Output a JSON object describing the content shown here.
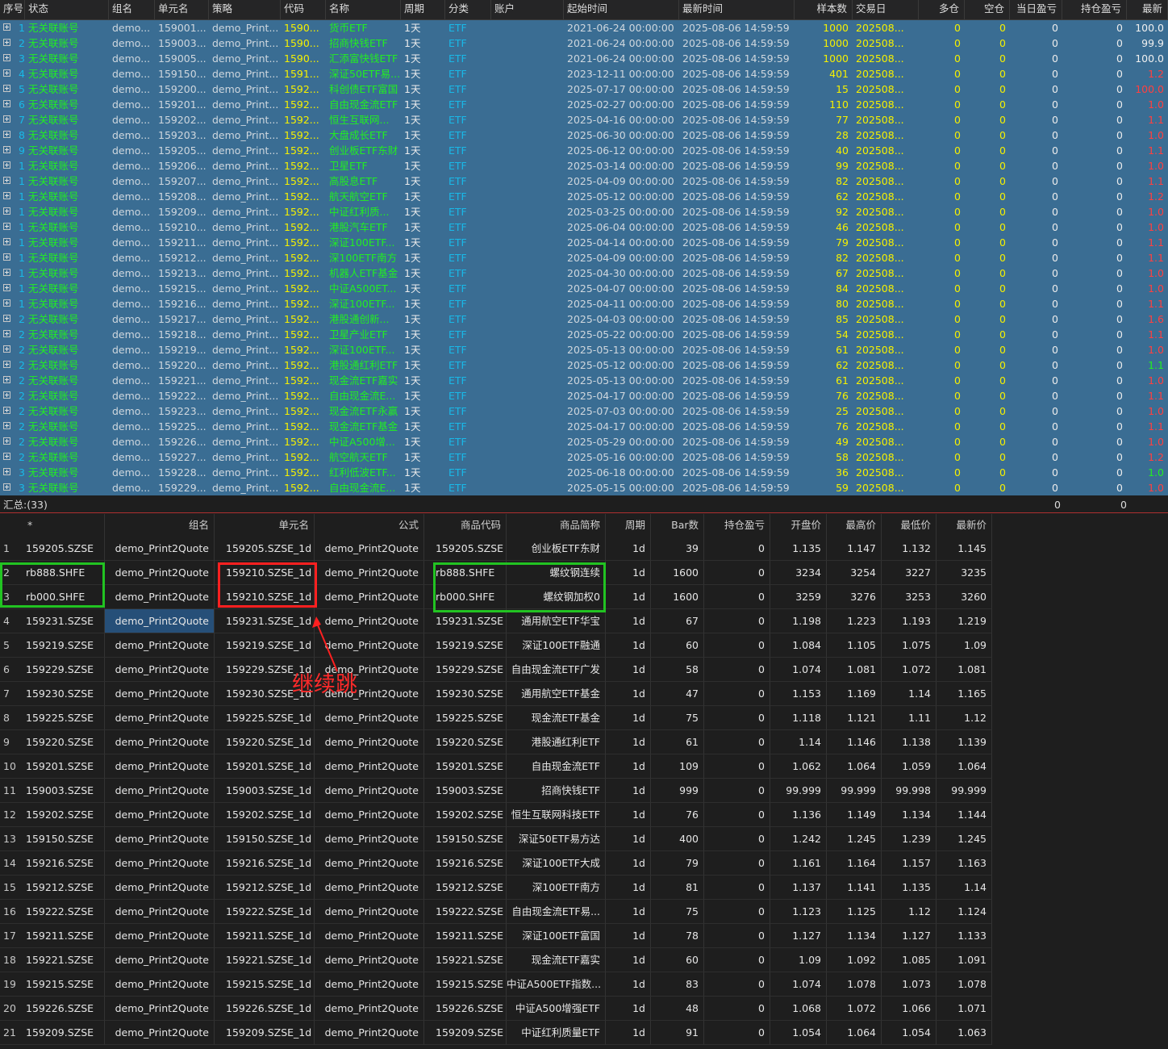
{
  "top": {
    "headers": [
      "序号",
      "状态",
      "组名",
      "单元名",
      "策略",
      "代码",
      "名称",
      "周期",
      "分类",
      "账户",
      "起始时间",
      "最新时间",
      "样本数",
      "交易日",
      "多仓",
      "空仓",
      "当日盈亏",
      "持仓盈亏",
      "最新"
    ],
    "rows": [
      [
        "1",
        "无关联账号",
        "demo...",
        "159001...",
        "demo_Print...",
        "1590...",
        "货币ETF",
        "1天",
        "ETF",
        "",
        "2021-06-24 00:00:00",
        "2025-08-06 14:59:59",
        "1000",
        "202508...",
        "0",
        "0",
        "0",
        "0",
        "100.0"
      ],
      [
        "2",
        "无关联账号",
        "demo...",
        "159003...",
        "demo_Print...",
        "1590...",
        "招商快钱ETF",
        "1天",
        "ETF",
        "",
        "2021-06-24 00:00:00",
        "2025-08-06 14:59:59",
        "1000",
        "202508...",
        "0",
        "0",
        "0",
        "0",
        "99.9"
      ],
      [
        "3",
        "无关联账号",
        "demo...",
        "159005...",
        "demo_Print...",
        "1590...",
        "汇添富快钱ETF",
        "1天",
        "ETF",
        "",
        "2021-06-24 00:00:00",
        "2025-08-06 14:59:59",
        "1000",
        "202508...",
        "0",
        "0",
        "0",
        "0",
        "100.0"
      ],
      [
        "4",
        "无关联账号",
        "demo...",
        "159150...",
        "demo_Print...",
        "1591...",
        "深证50ETF易...",
        "1天",
        "ETF",
        "",
        "2023-12-11 00:00:00",
        "2025-08-06 14:59:59",
        "401",
        "202508...",
        "0",
        "0",
        "0",
        "0",
        "1.2"
      ],
      [
        "5",
        "无关联账号",
        "demo...",
        "159200...",
        "demo_Print...",
        "1592...",
        "科创债ETF富国",
        "1天",
        "ETF",
        "",
        "2025-07-17 00:00:00",
        "2025-08-06 14:59:59",
        "15",
        "202508...",
        "0",
        "0",
        "0",
        "0",
        "100.0"
      ],
      [
        "6",
        "无关联账号",
        "demo...",
        "159201...",
        "demo_Print...",
        "1592...",
        "自由现金流ETF",
        "1天",
        "ETF",
        "",
        "2025-02-27 00:00:00",
        "2025-08-06 14:59:59",
        "110",
        "202508...",
        "0",
        "0",
        "0",
        "0",
        "1.0"
      ],
      [
        "7",
        "无关联账号",
        "demo...",
        "159202...",
        "demo_Print...",
        "1592...",
        "恒生互联网...",
        "1天",
        "ETF",
        "",
        "2025-04-16 00:00:00",
        "2025-08-06 14:59:59",
        "77",
        "202508...",
        "0",
        "0",
        "0",
        "0",
        "1.1"
      ],
      [
        "8",
        "无关联账号",
        "demo...",
        "159203...",
        "demo_Print...",
        "1592...",
        "大盘成长ETF",
        "1天",
        "ETF",
        "",
        "2025-06-30 00:00:00",
        "2025-08-06 14:59:59",
        "28",
        "202508...",
        "0",
        "0",
        "0",
        "0",
        "1.0"
      ],
      [
        "9",
        "无关联账号",
        "demo...",
        "159205...",
        "demo_Print...",
        "1592...",
        "创业板ETF东财",
        "1天",
        "ETF",
        "",
        "2025-06-12 00:00:00",
        "2025-08-06 14:59:59",
        "40",
        "202508...",
        "0",
        "0",
        "0",
        "0",
        "1.1"
      ],
      [
        "10",
        "无关联账号",
        "demo...",
        "159206...",
        "demo_Print...",
        "1592...",
        "卫星ETF",
        "1天",
        "ETF",
        "",
        "2025-03-14 00:00:00",
        "2025-08-06 14:59:59",
        "99",
        "202508...",
        "0",
        "0",
        "0",
        "0",
        "1.0"
      ],
      [
        "11",
        "无关联账号",
        "demo...",
        "159207...",
        "demo_Print...",
        "1592...",
        "高股息ETF",
        "1天",
        "ETF",
        "",
        "2025-04-09 00:00:00",
        "2025-08-06 14:59:59",
        "82",
        "202508...",
        "0",
        "0",
        "0",
        "0",
        "1.1"
      ],
      [
        "12",
        "无关联账号",
        "demo...",
        "159208...",
        "demo_Print...",
        "1592...",
        "航天航空ETF",
        "1天",
        "ETF",
        "",
        "2025-05-12 00:00:00",
        "2025-08-06 14:59:59",
        "62",
        "202508...",
        "0",
        "0",
        "0",
        "0",
        "1.2"
      ],
      [
        "13",
        "无关联账号",
        "demo...",
        "159209...",
        "demo_Print...",
        "1592...",
        "中证红利质...",
        "1天",
        "ETF",
        "",
        "2025-03-25 00:00:00",
        "2025-08-06 14:59:59",
        "92",
        "202508...",
        "0",
        "0",
        "0",
        "0",
        "1.0"
      ],
      [
        "14",
        "无关联账号",
        "demo...",
        "159210...",
        "demo_Print...",
        "1592...",
        "港股汽车ETF",
        "1天",
        "ETF",
        "",
        "2025-06-04 00:00:00",
        "2025-08-06 14:59:59",
        "46",
        "202508...",
        "0",
        "0",
        "0",
        "0",
        "1.0"
      ],
      [
        "15",
        "无关联账号",
        "demo...",
        "159211...",
        "demo_Print...",
        "1592...",
        "深证100ETF...",
        "1天",
        "ETF",
        "",
        "2025-04-14 00:00:00",
        "2025-08-06 14:59:59",
        "79",
        "202508...",
        "0",
        "0",
        "0",
        "0",
        "1.1"
      ],
      [
        "16",
        "无关联账号",
        "demo...",
        "159212...",
        "demo_Print...",
        "1592...",
        "深100ETF南方",
        "1天",
        "ETF",
        "",
        "2025-04-09 00:00:00",
        "2025-08-06 14:59:59",
        "82",
        "202508...",
        "0",
        "0",
        "0",
        "0",
        "1.1"
      ],
      [
        "17",
        "无关联账号",
        "demo...",
        "159213...",
        "demo_Print...",
        "1592...",
        "机器人ETF基金",
        "1天",
        "ETF",
        "",
        "2025-04-30 00:00:00",
        "2025-08-06 14:59:59",
        "67",
        "202508...",
        "0",
        "0",
        "0",
        "0",
        "1.0"
      ],
      [
        "18",
        "无关联账号",
        "demo...",
        "159215...",
        "demo_Print...",
        "1592...",
        "中证A500ET...",
        "1天",
        "ETF",
        "",
        "2025-04-07 00:00:00",
        "2025-08-06 14:59:59",
        "84",
        "202508...",
        "0",
        "0",
        "0",
        "0",
        "1.0"
      ],
      [
        "19",
        "无关联账号",
        "demo...",
        "159216...",
        "demo_Print...",
        "1592...",
        "深证100ETF...",
        "1天",
        "ETF",
        "",
        "2025-04-11 00:00:00",
        "2025-08-06 14:59:59",
        "80",
        "202508...",
        "0",
        "0",
        "0",
        "0",
        "1.1"
      ],
      [
        "20",
        "无关联账号",
        "demo...",
        "159217...",
        "demo_Print...",
        "1592...",
        "港股通创新...",
        "1天",
        "ETF",
        "",
        "2025-04-03 00:00:00",
        "2025-08-06 14:59:59",
        "85",
        "202508...",
        "0",
        "0",
        "0",
        "0",
        "1.6"
      ],
      [
        "21",
        "无关联账号",
        "demo...",
        "159218...",
        "demo_Print...",
        "1592...",
        "卫星产业ETF",
        "1天",
        "ETF",
        "",
        "2025-05-22 00:00:00",
        "2025-08-06 14:59:59",
        "54",
        "202508...",
        "0",
        "0",
        "0",
        "0",
        "1.1"
      ],
      [
        "22",
        "无关联账号",
        "demo...",
        "159219...",
        "demo_Print...",
        "1592...",
        "深证100ETF...",
        "1天",
        "ETF",
        "",
        "2025-05-13 00:00:00",
        "2025-08-06 14:59:59",
        "61",
        "202508...",
        "0",
        "0",
        "0",
        "0",
        "1.0"
      ],
      [
        "23",
        "无关联账号",
        "demo...",
        "159220...",
        "demo_Print...",
        "1592...",
        "港股通红利ETF",
        "1天",
        "ETF",
        "",
        "2025-05-12 00:00:00",
        "2025-08-06 14:59:59",
        "62",
        "202508...",
        "0",
        "0",
        "0",
        "0",
        "1.1"
      ],
      [
        "24",
        "无关联账号",
        "demo...",
        "159221...",
        "demo_Print...",
        "1592...",
        "现金流ETF嘉实",
        "1天",
        "ETF",
        "",
        "2025-05-13 00:00:00",
        "2025-08-06 14:59:59",
        "61",
        "202508...",
        "0",
        "0",
        "0",
        "0",
        "1.0"
      ],
      [
        "25",
        "无关联账号",
        "demo...",
        "159222...",
        "demo_Print...",
        "1592...",
        "自由现金流E...",
        "1天",
        "ETF",
        "",
        "2025-04-17 00:00:00",
        "2025-08-06 14:59:59",
        "76",
        "202508...",
        "0",
        "0",
        "0",
        "0",
        "1.1"
      ],
      [
        "26",
        "无关联账号",
        "demo...",
        "159223...",
        "demo_Print...",
        "1592...",
        "现金流ETF永赢",
        "1天",
        "ETF",
        "",
        "2025-07-03 00:00:00",
        "2025-08-06 14:59:59",
        "25",
        "202508...",
        "0",
        "0",
        "0",
        "0",
        "1.0"
      ],
      [
        "27",
        "无关联账号",
        "demo...",
        "159225...",
        "demo_Print...",
        "1592...",
        "现金流ETF基金",
        "1天",
        "ETF",
        "",
        "2025-04-17 00:00:00",
        "2025-08-06 14:59:59",
        "76",
        "202508...",
        "0",
        "0",
        "0",
        "0",
        "1.1"
      ],
      [
        "28",
        "无关联账号",
        "demo...",
        "159226...",
        "demo_Print...",
        "1592...",
        "中证A500增...",
        "1天",
        "ETF",
        "",
        "2025-05-29 00:00:00",
        "2025-08-06 14:59:59",
        "49",
        "202508...",
        "0",
        "0",
        "0",
        "0",
        "1.0"
      ],
      [
        "29",
        "无关联账号",
        "demo...",
        "159227...",
        "demo_Print...",
        "1592...",
        "航空航天ETF",
        "1天",
        "ETF",
        "",
        "2025-05-16 00:00:00",
        "2025-08-06 14:59:59",
        "58",
        "202508...",
        "0",
        "0",
        "0",
        "0",
        "1.2"
      ],
      [
        "30",
        "无关联账号",
        "demo...",
        "159228...",
        "demo_Print...",
        "1592...",
        "红利低波ETF...",
        "1天",
        "ETF",
        "",
        "2025-06-18 00:00:00",
        "2025-08-06 14:59:59",
        "36",
        "202508...",
        "0",
        "0",
        "0",
        "0",
        "1.0"
      ],
      [
        "31",
        "无关联账号",
        "demo...",
        "159229...",
        "demo_Print...",
        "1592...",
        "自由现金流E...",
        "1天",
        "ETF",
        "",
        "2025-05-15 00:00:00",
        "2025-08-06 14:59:59",
        "59",
        "202508...",
        "0",
        "0",
        "0",
        "0",
        "1.0"
      ]
    ],
    "latest_colors": [
      "white",
      "white",
      "white",
      "red",
      "red",
      "red",
      "red",
      "red",
      "red",
      "red",
      "red",
      "red",
      "red",
      "red",
      "red",
      "red",
      "red",
      "red",
      "red",
      "red",
      "red",
      "red",
      "green",
      "red",
      "red",
      "red",
      "red",
      "red",
      "red",
      "green",
      "red"
    ]
  },
  "summary": {
    "label": "汇总:(33)",
    "daily_pnl": "0",
    "position_pnl": "0"
  },
  "bottom": {
    "headers": [
      "*",
      "组名",
      "单元名",
      "公式",
      "商品代码",
      "商品简称",
      "周期",
      "Bar数",
      "持仓盈亏",
      "开盘价",
      "最高价",
      "最低价",
      "最新价"
    ],
    "rows": [
      [
        "1",
        "159205.SZSE",
        "demo_Print2Quote",
        "159205.SZSE_1d",
        "demo_Print2Quote",
        "159205.SZSE",
        "创业板ETF东财",
        "1d",
        "39",
        "0",
        "1.135",
        "1.147",
        "1.132",
        "1.145"
      ],
      [
        "2",
        "rb888.SHFE",
        "demo_Print2Quote",
        "159210.SZSE_1d",
        "demo_Print2Quote",
        "rb888.SHFE",
        "螺纹钢连续",
        "1d",
        "1600",
        "0",
        "3234",
        "3254",
        "3227",
        "3235"
      ],
      [
        "3",
        "rb000.SHFE",
        "demo_Print2Quote",
        "159210.SZSE_1d",
        "demo_Print2Quote",
        "rb000.SHFE",
        "螺纹钢加权0",
        "1d",
        "1600",
        "0",
        "3259",
        "3276",
        "3253",
        "3260"
      ],
      [
        "4",
        "159231.SZSE",
        "demo_Print2Quote",
        "159231.SZSE_1d",
        "demo_Print2Quote",
        "159231.SZSE",
        "通用航空ETF华宝",
        "1d",
        "67",
        "0",
        "1.198",
        "1.223",
        "1.193",
        "1.219"
      ],
      [
        "5",
        "159219.SZSE",
        "demo_Print2Quote",
        "159219.SZSE_1d",
        "demo_Print2Quote",
        "159219.SZSE",
        "深证100ETF融通",
        "1d",
        "60",
        "0",
        "1.084",
        "1.105",
        "1.075",
        "1.09"
      ],
      [
        "6",
        "159229.SZSE",
        "demo_Print2Quote",
        "159229.SZSE_1d",
        "demo_Print2Quote",
        "159229.SZSE",
        "自由现金流ETF广发",
        "1d",
        "58",
        "0",
        "1.074",
        "1.081",
        "1.072",
        "1.081"
      ],
      [
        "7",
        "159230.SZSE",
        "demo_Print2Quote",
        "159230.SZSE_1d",
        "demo_Print2Quote",
        "159230.SZSE",
        "通用航空ETF基金",
        "1d",
        "47",
        "0",
        "1.153",
        "1.169",
        "1.14",
        "1.165"
      ],
      [
        "8",
        "159225.SZSE",
        "demo_Print2Quote",
        "159225.SZSE_1d",
        "demo_Print2Quote",
        "159225.SZSE",
        "现金流ETF基金",
        "1d",
        "75",
        "0",
        "1.118",
        "1.121",
        "1.11",
        "1.12"
      ],
      [
        "9",
        "159220.SZSE",
        "demo_Print2Quote",
        "159220.SZSE_1d",
        "demo_Print2Quote",
        "159220.SZSE",
        "港股通红利ETF",
        "1d",
        "61",
        "0",
        "1.14",
        "1.146",
        "1.138",
        "1.139"
      ],
      [
        "10",
        "159201.SZSE",
        "demo_Print2Quote",
        "159201.SZSE_1d",
        "demo_Print2Quote",
        "159201.SZSE",
        "自由现金流ETF",
        "1d",
        "109",
        "0",
        "1.062",
        "1.064",
        "1.059",
        "1.064"
      ],
      [
        "11",
        "159003.SZSE",
        "demo_Print2Quote",
        "159003.SZSE_1d",
        "demo_Print2Quote",
        "159003.SZSE",
        "招商快钱ETF",
        "1d",
        "999",
        "0",
        "99.999",
        "99.999",
        "99.998",
        "99.999"
      ],
      [
        "12",
        "159202.SZSE",
        "demo_Print2Quote",
        "159202.SZSE_1d",
        "demo_Print2Quote",
        "159202.SZSE",
        "恒生互联网科技ETF",
        "1d",
        "76",
        "0",
        "1.136",
        "1.149",
        "1.134",
        "1.144"
      ],
      [
        "13",
        "159150.SZSE",
        "demo_Print2Quote",
        "159150.SZSE_1d",
        "demo_Print2Quote",
        "159150.SZSE",
        "深证50ETF易方达",
        "1d",
        "400",
        "0",
        "1.242",
        "1.245",
        "1.239",
        "1.245"
      ],
      [
        "14",
        "159216.SZSE",
        "demo_Print2Quote",
        "159216.SZSE_1d",
        "demo_Print2Quote",
        "159216.SZSE",
        "深证100ETF大成",
        "1d",
        "79",
        "0",
        "1.161",
        "1.164",
        "1.157",
        "1.163"
      ],
      [
        "15",
        "159212.SZSE",
        "demo_Print2Quote",
        "159212.SZSE_1d",
        "demo_Print2Quote",
        "159212.SZSE",
        "深100ETF南方",
        "1d",
        "81",
        "0",
        "1.137",
        "1.141",
        "1.135",
        "1.14"
      ],
      [
        "16",
        "159222.SZSE",
        "demo_Print2Quote",
        "159222.SZSE_1d",
        "demo_Print2Quote",
        "159222.SZSE",
        "自由现金流ETF易...",
        "1d",
        "75",
        "0",
        "1.123",
        "1.125",
        "1.12",
        "1.124"
      ],
      [
        "17",
        "159211.SZSE",
        "demo_Print2Quote",
        "159211.SZSE_1d",
        "demo_Print2Quote",
        "159211.SZSE",
        "深证100ETF富国",
        "1d",
        "78",
        "0",
        "1.127",
        "1.134",
        "1.127",
        "1.133"
      ],
      [
        "18",
        "159221.SZSE",
        "demo_Print2Quote",
        "159221.SZSE_1d",
        "demo_Print2Quote",
        "159221.SZSE",
        "现金流ETF嘉实",
        "1d",
        "60",
        "0",
        "1.09",
        "1.092",
        "1.085",
        "1.091"
      ],
      [
        "19",
        "159215.SZSE",
        "demo_Print2Quote",
        "159215.SZSE_1d",
        "demo_Print2Quote",
        "159215.SZSE",
        "中证A500ETF指数...",
        "1d",
        "83",
        "0",
        "1.074",
        "1.078",
        "1.073",
        "1.078"
      ],
      [
        "20",
        "159226.SZSE",
        "demo_Print2Quote",
        "159226.SZSE_1d",
        "demo_Print2Quote",
        "159226.SZSE",
        "中证A500增强ETF",
        "1d",
        "48",
        "0",
        "1.068",
        "1.072",
        "1.066",
        "1.071"
      ],
      [
        "21",
        "159209.SZSE",
        "demo_Print2Quote",
        "159209.SZSE_1d",
        "demo_Print2Quote",
        "159209.SZSE",
        "中证红利质量ETF",
        "1d",
        "91",
        "0",
        "1.054",
        "1.064",
        "1.054",
        "1.063"
      ]
    ]
  },
  "annotation": {
    "text": "继续跳"
  },
  "colors": {
    "row_bg": "#3a6d93",
    "green": "#22ee22",
    "cyan": "#19b9e8",
    "yellow": "#f5f000",
    "red": "#ff4040",
    "anno_red": "#ff2020",
    "anno_green": "#22c322"
  }
}
